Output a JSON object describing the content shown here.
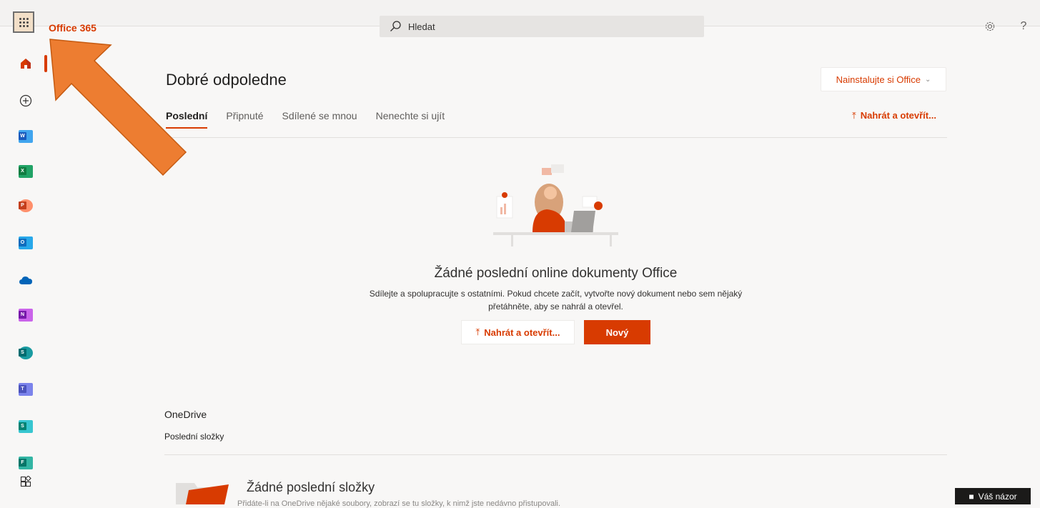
{
  "header": {
    "brand": "Office 365",
    "search_placeholder": "Hledat"
  },
  "sidebar": {
    "items": [
      {
        "name": "home-icon",
        "label": "Home"
      },
      {
        "name": "create-icon",
        "label": "Create"
      },
      {
        "name": "word-icon",
        "letter": "W",
        "color": "#185abd"
      },
      {
        "name": "excel-icon",
        "letter": "X",
        "color": "#107c41"
      },
      {
        "name": "powerpoint-icon",
        "letter": "P",
        "color": "#c43e1c"
      },
      {
        "name": "outlook-icon",
        "letter": "O",
        "color": "#0f6cbd"
      },
      {
        "name": "onedrive-icon",
        "color": "#0364b8"
      },
      {
        "name": "onenote-icon",
        "letter": "N",
        "color": "#7719aa"
      },
      {
        "name": "sharepoint-icon",
        "letter": "S",
        "color": "#036c70"
      },
      {
        "name": "teams-icon",
        "letter": "T",
        "color": "#4b53bc"
      },
      {
        "name": "sway-icon",
        "letter": "S",
        "color": "#008272"
      },
      {
        "name": "forms-icon",
        "letter": "F",
        "color": "#077568"
      },
      {
        "name": "all-apps-icon"
      }
    ]
  },
  "main": {
    "greeting": "Dobré odpoledne",
    "install_button": "Nainstalujte si Office",
    "tabs": [
      {
        "label": "Poslední",
        "active": true
      },
      {
        "label": "Připnuté",
        "active": false
      },
      {
        "label": "Sdílené se mnou",
        "active": false
      },
      {
        "label": "Nenechte si ujít",
        "active": false
      }
    ],
    "upload_link": "Nahrát a otevřít...",
    "empty_state": {
      "title": "Žádné poslední online dokumenty Office",
      "description": "Sdílejte a spolupracujte s ostatními. Pokud chcete začít, vytvořte nový dokument nebo sem nějaký přetáhněte, aby se nahrál a otevřel.",
      "upload_button": "Nahrát a otevřít...",
      "new_button": "Nový"
    },
    "onedrive": {
      "title": "OneDrive",
      "subtitle": "Poslední složky",
      "empty_title": "Žádné poslední složky",
      "empty_desc": "Přidáte-li na OneDrive nějaké soubory, zobrazí se tu složky, k nimž jste nedávno přistupovali."
    }
  },
  "feedback": {
    "label": "Váš názor"
  },
  "colors": {
    "accent": "#d83b01",
    "arrow": "#ed7d31"
  }
}
